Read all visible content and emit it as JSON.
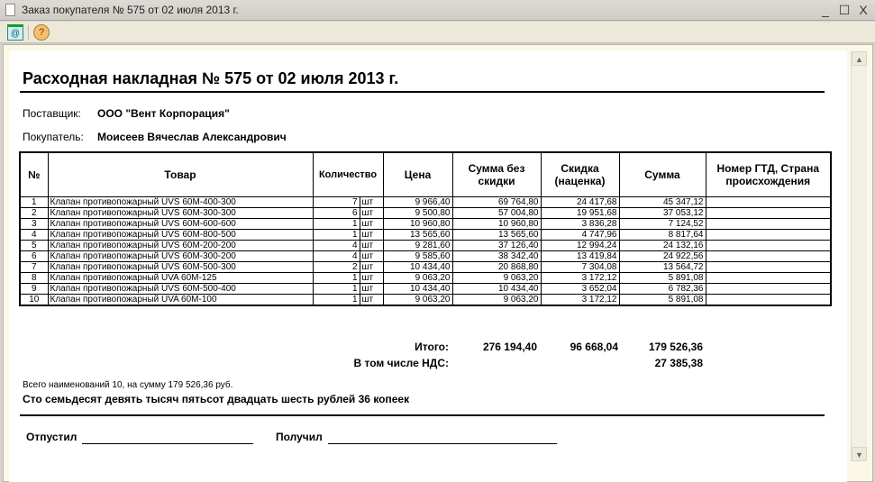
{
  "window": {
    "title": "Заказ покупателя № 575 от 02 июля 2013 г."
  },
  "doc": {
    "title": "Расходная накладная № 575 от 02 июля 2013 г.",
    "supplier_label": "Поставщик:",
    "supplier": "ООО \"Вент Корпорация\"",
    "buyer_label": "Покупатель:",
    "buyer": "Моисеев Вячеслав Александрович",
    "headers": {
      "num": "№",
      "item": "Товар",
      "qty": "Количество",
      "price": "Цена",
      "sum_nodisc": "Сумма без скидки",
      "discount": "Скидка (наценка)",
      "sum": "Сумма",
      "gtd": "Номер ГТД, Страна происхождения"
    },
    "rows": [
      {
        "n": "1",
        "item": "Клапан противопожарный UVS 60М-400-300",
        "qty": "7",
        "unit": "шт",
        "price": "9 966,40",
        "sum_nodisc": "69 764,80",
        "discount": "24 417,68",
        "sum": "45 347,12",
        "gtd": ""
      },
      {
        "n": "2",
        "item": "Клапан противопожарный UVS 60М-300-300",
        "qty": "6",
        "unit": "шт",
        "price": "9 500,80",
        "sum_nodisc": "57 004,80",
        "discount": "19 951,68",
        "sum": "37 053,12",
        "gtd": ""
      },
      {
        "n": "3",
        "item": "Клапан противопожарный UVS 60М-600-600",
        "qty": "1",
        "unit": "шт",
        "price": "10 960,80",
        "sum_nodisc": "10 960,80",
        "discount": "3 836,28",
        "sum": "7 124,52",
        "gtd": ""
      },
      {
        "n": "4",
        "item": "Клапан противопожарный UVS 60М-800-500",
        "qty": "1",
        "unit": "шт",
        "price": "13 565,60",
        "sum_nodisc": "13 565,60",
        "discount": "4 747,96",
        "sum": "8 817,64",
        "gtd": ""
      },
      {
        "n": "5",
        "item": "Клапан противопожарный UVS 60М-200-200",
        "qty": "4",
        "unit": "шт",
        "price": "9 281,60",
        "sum_nodisc": "37 126,40",
        "discount": "12 994,24",
        "sum": "24 132,16",
        "gtd": ""
      },
      {
        "n": "6",
        "item": "Клапан противопожарный UVS 60М-300-200",
        "qty": "4",
        "unit": "шт",
        "price": "9 585,60",
        "sum_nodisc": "38 342,40",
        "discount": "13 419,84",
        "sum": "24 922,56",
        "gtd": ""
      },
      {
        "n": "7",
        "item": "Клапан противопожарный UVS 60М-500-300",
        "qty": "2",
        "unit": "шт",
        "price": "10 434,40",
        "sum_nodisc": "20 868,80",
        "discount": "7 304,08",
        "sum": "13 564,72",
        "gtd": ""
      },
      {
        "n": "8",
        "item": "Клапан противопожарный UVA 60М-125",
        "qty": "1",
        "unit": "шт",
        "price": "9 063,20",
        "sum_nodisc": "9 063,20",
        "discount": "3 172,12",
        "sum": "5 891,08",
        "gtd": ""
      },
      {
        "n": "9",
        "item": "Клапан противопожарный UVS 60М-500-400",
        "qty": "1",
        "unit": "шт",
        "price": "10 434,40",
        "sum_nodisc": "10 434,40",
        "discount": "3 652,04",
        "sum": "6 782,36",
        "gtd": ""
      },
      {
        "n": "10",
        "item": "Клапан противопожарный UVA 60М-100",
        "qty": "1",
        "unit": "шт",
        "price": "9 063,20",
        "sum_nodisc": "9 063,20",
        "discount": "3 172,12",
        "sum": "5 891,08",
        "gtd": ""
      }
    ],
    "totals": {
      "label": "Итого:",
      "sum_nodisc": "276 194,40",
      "discount": "96 668,04",
      "sum": "179 526,36",
      "vat_label": "В том числе НДС:",
      "vat": "27 385,38"
    },
    "summary": "Всего наименований 10, на сумму 179 526,36 руб.",
    "amount_words": "Сто семьдесят девять тысяч пятьсот двадцать шесть рублей 36 копеек",
    "released_label": "Отпустил",
    "received_label": "Получил"
  }
}
